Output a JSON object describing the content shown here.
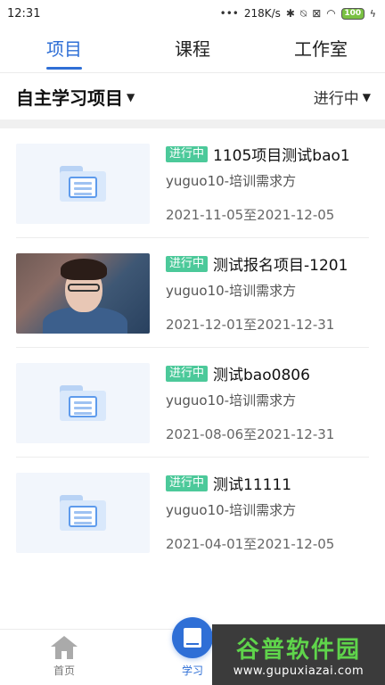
{
  "status_bar": {
    "time": "12:31",
    "network_speed": "218K/s",
    "battery": "100"
  },
  "top_tabs": [
    {
      "label": "项目",
      "active": true
    },
    {
      "label": "课程",
      "active": false
    },
    {
      "label": "工作室",
      "active": false
    }
  ],
  "filter": {
    "category": "自主学习项目",
    "status": "进行中"
  },
  "projects": [
    {
      "status": "进行中",
      "title": "1105项目测试bao1",
      "org": "yuguo10-培训需求方",
      "dates": "2021-11-05至2021-12-05",
      "thumb": "folder-icon"
    },
    {
      "status": "进行中",
      "title": "测试报名项目-1201",
      "org": "yuguo10-培训需求方",
      "dates": "2021-12-01至2021-12-31",
      "thumb": "photo"
    },
    {
      "status": "进行中",
      "title": "测试bao0806",
      "org": "yuguo10-培训需求方",
      "dates": "2021-08-06至2021-12-31",
      "thumb": "folder-icon"
    },
    {
      "status": "进行中",
      "title": "测试11111",
      "org": "yuguo10-培训需求方",
      "dates": "2021-04-01至2021-12-05",
      "thumb": "folder-icon"
    }
  ],
  "bottom_nav": [
    {
      "label": "首页",
      "icon": "home-icon",
      "active": false
    },
    {
      "label": "学习",
      "icon": "book-icon",
      "active": true
    }
  ],
  "watermark": {
    "brand": "谷普软件园",
    "url": "www.gupuxiazai.com"
  },
  "colors": {
    "accent": "#2f6fd6",
    "status_tag": "#4cc99a"
  }
}
